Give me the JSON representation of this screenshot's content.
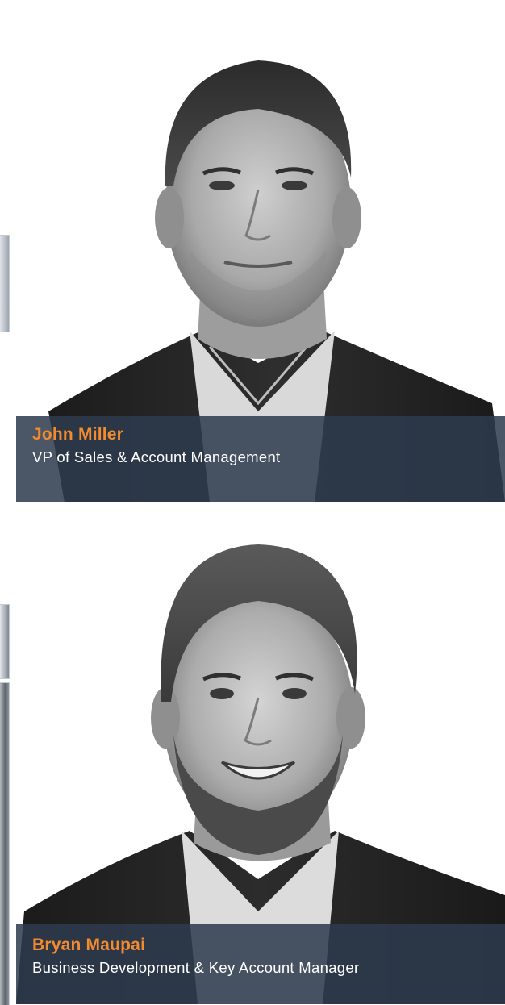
{
  "team": [
    {
      "name": "John Miller",
      "title": "VP of Sales & Account Management"
    },
    {
      "name": "Bryan Maupai",
      "title": "Business Development & Key Account Manager"
    }
  ],
  "colors": {
    "name_accent": "#f28a2e",
    "caption_background": "#2d3a4e",
    "title_text": "#ffffff",
    "page_background": "#ffffff"
  },
  "icons": {
    "portrait_1": "headshot-photo",
    "portrait_2": "headshot-photo"
  }
}
